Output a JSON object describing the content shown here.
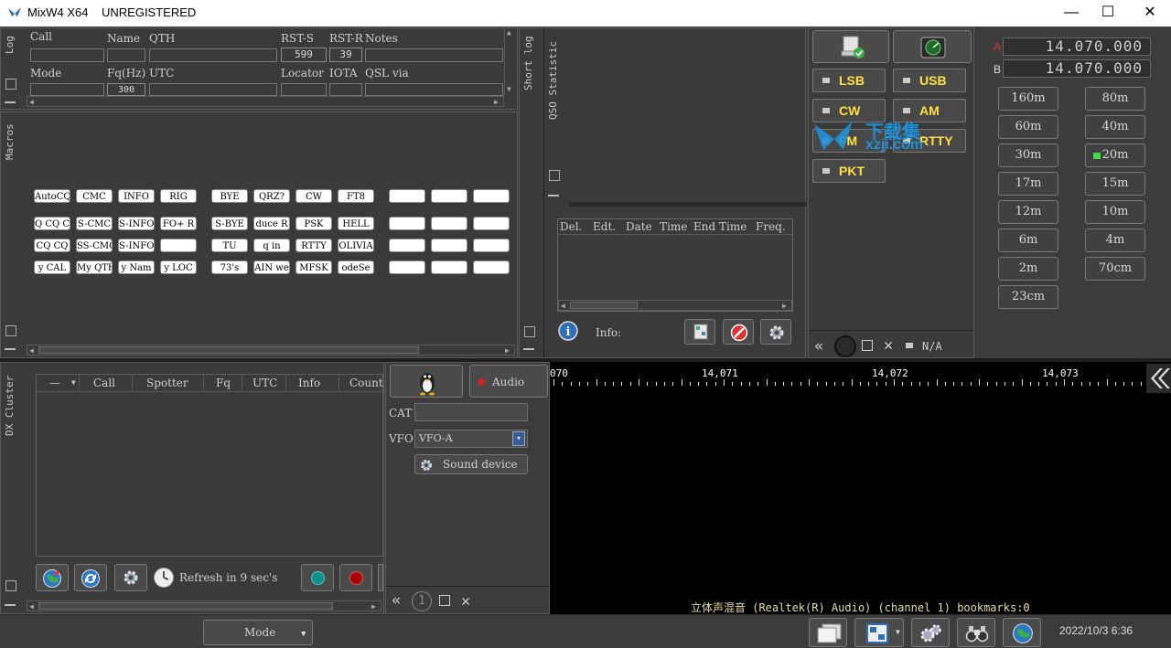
{
  "window": {
    "app_title": "MixW4 X64",
    "status": "UNREGISTERED",
    "minimize": "—",
    "maximize": "☐",
    "close": "✕"
  },
  "log": {
    "tab": "Log",
    "labels": {
      "call": "Call",
      "name": "Name",
      "qth": "QTH",
      "rst_s": "RST-S",
      "rst_r": "RST-R",
      "notes": "Notes",
      "mode": "Mode",
      "fq": "Fq(Hz)",
      "utc": "UTC",
      "locator": "Locator",
      "iota": "IOTA",
      "qsl_via": "QSL via"
    },
    "values": {
      "rst_s": "599",
      "rst_r": "39",
      "fq": "300"
    }
  },
  "macros": {
    "tab": "Macros",
    "rows": [
      [
        "AutoCQ",
        "CMC",
        "INFO",
        "RIG",
        "BYE",
        "QRZ?",
        "CW",
        "FT8",
        "",
        "",
        ""
      ],
      [
        "Q CQ C",
        "S-CMC",
        "S-INFO",
        "FO+ R",
        "S-BYE",
        "duce R",
        "PSK",
        "HELL",
        "",
        "",
        ""
      ],
      [
        "CQ CQ",
        "SS-CMC",
        "S-INFO",
        "",
        "TU",
        "q in",
        "RTTY",
        "OLIVIA",
        "",
        "",
        ""
      ],
      [
        "y CAL",
        "My QTH",
        "y Nam",
        "y LOC",
        "73's",
        "AIN we",
        "MFSK",
        "odeSe",
        "",
        "",
        ""
      ]
    ]
  },
  "short_log": {
    "tab1": "Short log",
    "tab2": "QSO Statistic",
    "columns": [
      "Del.",
      "Edt.",
      "Date",
      "Time",
      "End Time",
      "Freq."
    ],
    "info_label": "Info:"
  },
  "modes": {
    "buttons": [
      "LSB",
      "USB",
      "CW",
      "AM",
      "FM",
      "RTTY",
      "PKT"
    ],
    "na": "N/A"
  },
  "vfo": {
    "a_label": "A",
    "b_label": "B",
    "a_freq": "14.070.000",
    "b_freq": "14.070.000"
  },
  "bands": [
    "160m",
    "80m",
    "60m",
    "40m",
    "30m",
    "20m",
    "17m",
    "15m",
    "12m",
    "10m",
    "6m",
    "4m",
    "2m",
    "70cm",
    "23cm"
  ],
  "selected_band": "20m",
  "dx_cluster": {
    "tab": "DX Cluster",
    "columns": [
      "—",
      "Call",
      "Spotter",
      "Fq",
      "UTC",
      "Info",
      "Count"
    ],
    "refresh": "Refresh in 9 sec's"
  },
  "sound": {
    "audio_label": "Audio",
    "cat_label": "CAT",
    "vfo_label": "VFO",
    "vfo_value": "VFO-A",
    "sound_device": "Sound device",
    "circle_num": "1"
  },
  "waterfall": {
    "ticks": [
      "070",
      "14,071",
      "14,072",
      "14,073"
    ],
    "status": "立体声混音 (Realtek(R) Audio) (channel 1) bookmarks:0"
  },
  "statusbar": {
    "mode_button": "Mode",
    "datetime": "2022/10/3 6:36"
  },
  "watermark": {
    "text1": "下载集",
    "text2": "xzji.com"
  },
  "colors": {
    "accent_yellow": "#ffe040",
    "led_green": "#3ee04a",
    "led_red": "#d42020",
    "vfo_a_red": "#e03030"
  }
}
